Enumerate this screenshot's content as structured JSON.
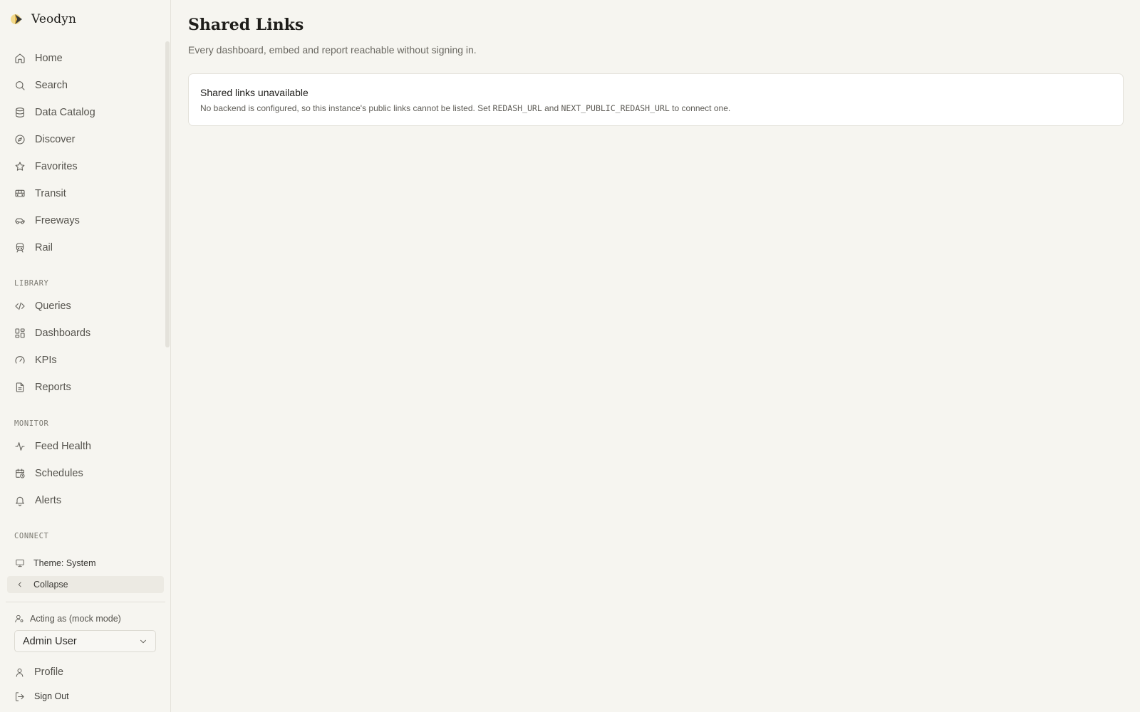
{
  "brand": {
    "name": "Veodyn"
  },
  "nav": {
    "primary": [
      {
        "label": "Home",
        "icon": "home-icon"
      },
      {
        "label": "Search",
        "icon": "search-icon"
      },
      {
        "label": "Data Catalog",
        "icon": "database-icon"
      },
      {
        "label": "Discover",
        "icon": "compass-icon"
      },
      {
        "label": "Favorites",
        "icon": "star-icon"
      },
      {
        "label": "Transit",
        "icon": "bus-icon"
      },
      {
        "label": "Freeways",
        "icon": "car-icon"
      },
      {
        "label": "Rail",
        "icon": "train-icon"
      }
    ],
    "library_label": "LIBRARY",
    "library": [
      {
        "label": "Queries",
        "icon": "code-icon"
      },
      {
        "label": "Dashboards",
        "icon": "dashboard-grid-icon"
      },
      {
        "label": "KPIs",
        "icon": "gauge-icon"
      },
      {
        "label": "Reports",
        "icon": "document-icon"
      }
    ],
    "monitor_label": "MONITOR",
    "monitor": [
      {
        "label": "Feed Health",
        "icon": "activity-icon"
      },
      {
        "label": "Schedules",
        "icon": "calendar-clock-icon"
      },
      {
        "label": "Alerts",
        "icon": "bell-icon"
      }
    ],
    "connect_label": "CONNECT"
  },
  "theme": {
    "label": "Theme: System"
  },
  "collapse": {
    "label": "Collapse"
  },
  "acting": {
    "label": "Acting as (mock mode)",
    "selected_user": "Admin User"
  },
  "account": {
    "profile": "Profile",
    "sign_out": "Sign Out"
  },
  "page": {
    "title": "Shared Links",
    "subtitle": "Every dashboard, embed and report reachable without signing in."
  },
  "notice": {
    "title": "Shared links unavailable",
    "body_prefix": "No backend is configured, so this instance's public links cannot be listed. Set ",
    "env_var_1": "REDASH_URL",
    "body_middle": " and ",
    "env_var_2": "NEXT_PUBLIC_REDASH_URL",
    "body_suffix": " to connect one."
  },
  "colors": {
    "background": "#f6f5f0",
    "card": "#ffffff",
    "border": "#e4e2db",
    "text": "#2b2a27",
    "muted": "#6b6962",
    "logo_yellow": "#e9b949",
    "logo_dark": "#3a3935"
  }
}
